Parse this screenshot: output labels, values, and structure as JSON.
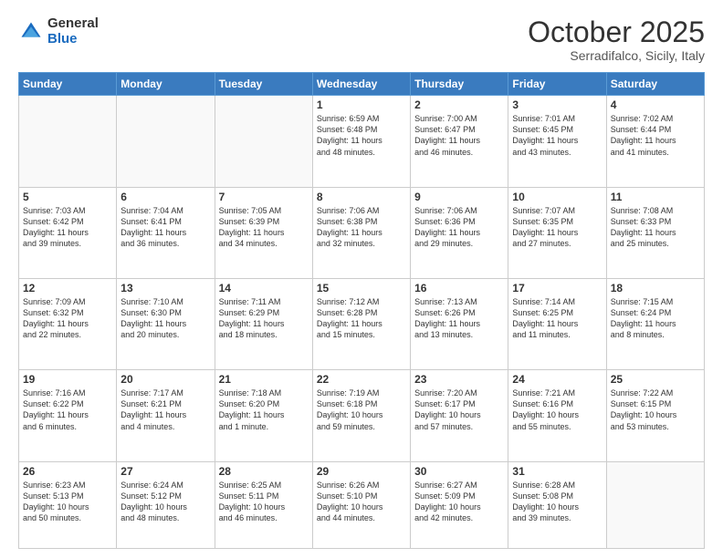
{
  "logo": {
    "general": "General",
    "blue": "Blue"
  },
  "header": {
    "month": "October 2025",
    "location": "Serradifalco, Sicily, Italy"
  },
  "weekdays": [
    "Sunday",
    "Monday",
    "Tuesday",
    "Wednesday",
    "Thursday",
    "Friday",
    "Saturday"
  ],
  "weeks": [
    [
      {
        "day": "",
        "info": ""
      },
      {
        "day": "",
        "info": ""
      },
      {
        "day": "",
        "info": ""
      },
      {
        "day": "1",
        "info": "Sunrise: 6:59 AM\nSunset: 6:48 PM\nDaylight: 11 hours\nand 48 minutes."
      },
      {
        "day": "2",
        "info": "Sunrise: 7:00 AM\nSunset: 6:47 PM\nDaylight: 11 hours\nand 46 minutes."
      },
      {
        "day": "3",
        "info": "Sunrise: 7:01 AM\nSunset: 6:45 PM\nDaylight: 11 hours\nand 43 minutes."
      },
      {
        "day": "4",
        "info": "Sunrise: 7:02 AM\nSunset: 6:44 PM\nDaylight: 11 hours\nand 41 minutes."
      }
    ],
    [
      {
        "day": "5",
        "info": "Sunrise: 7:03 AM\nSunset: 6:42 PM\nDaylight: 11 hours\nand 39 minutes."
      },
      {
        "day": "6",
        "info": "Sunrise: 7:04 AM\nSunset: 6:41 PM\nDaylight: 11 hours\nand 36 minutes."
      },
      {
        "day": "7",
        "info": "Sunrise: 7:05 AM\nSunset: 6:39 PM\nDaylight: 11 hours\nand 34 minutes."
      },
      {
        "day": "8",
        "info": "Sunrise: 7:06 AM\nSunset: 6:38 PM\nDaylight: 11 hours\nand 32 minutes."
      },
      {
        "day": "9",
        "info": "Sunrise: 7:06 AM\nSunset: 6:36 PM\nDaylight: 11 hours\nand 29 minutes."
      },
      {
        "day": "10",
        "info": "Sunrise: 7:07 AM\nSunset: 6:35 PM\nDaylight: 11 hours\nand 27 minutes."
      },
      {
        "day": "11",
        "info": "Sunrise: 7:08 AM\nSunset: 6:33 PM\nDaylight: 11 hours\nand 25 minutes."
      }
    ],
    [
      {
        "day": "12",
        "info": "Sunrise: 7:09 AM\nSunset: 6:32 PM\nDaylight: 11 hours\nand 22 minutes."
      },
      {
        "day": "13",
        "info": "Sunrise: 7:10 AM\nSunset: 6:30 PM\nDaylight: 11 hours\nand 20 minutes."
      },
      {
        "day": "14",
        "info": "Sunrise: 7:11 AM\nSunset: 6:29 PM\nDaylight: 11 hours\nand 18 minutes."
      },
      {
        "day": "15",
        "info": "Sunrise: 7:12 AM\nSunset: 6:28 PM\nDaylight: 11 hours\nand 15 minutes."
      },
      {
        "day": "16",
        "info": "Sunrise: 7:13 AM\nSunset: 6:26 PM\nDaylight: 11 hours\nand 13 minutes."
      },
      {
        "day": "17",
        "info": "Sunrise: 7:14 AM\nSunset: 6:25 PM\nDaylight: 11 hours\nand 11 minutes."
      },
      {
        "day": "18",
        "info": "Sunrise: 7:15 AM\nSunset: 6:24 PM\nDaylight: 11 hours\nand 8 minutes."
      }
    ],
    [
      {
        "day": "19",
        "info": "Sunrise: 7:16 AM\nSunset: 6:22 PM\nDaylight: 11 hours\nand 6 minutes."
      },
      {
        "day": "20",
        "info": "Sunrise: 7:17 AM\nSunset: 6:21 PM\nDaylight: 11 hours\nand 4 minutes."
      },
      {
        "day": "21",
        "info": "Sunrise: 7:18 AM\nSunset: 6:20 PM\nDaylight: 11 hours\nand 1 minute."
      },
      {
        "day": "22",
        "info": "Sunrise: 7:19 AM\nSunset: 6:18 PM\nDaylight: 10 hours\nand 59 minutes."
      },
      {
        "day": "23",
        "info": "Sunrise: 7:20 AM\nSunset: 6:17 PM\nDaylight: 10 hours\nand 57 minutes."
      },
      {
        "day": "24",
        "info": "Sunrise: 7:21 AM\nSunset: 6:16 PM\nDaylight: 10 hours\nand 55 minutes."
      },
      {
        "day": "25",
        "info": "Sunrise: 7:22 AM\nSunset: 6:15 PM\nDaylight: 10 hours\nand 53 minutes."
      }
    ],
    [
      {
        "day": "26",
        "info": "Sunrise: 6:23 AM\nSunset: 5:13 PM\nDaylight: 10 hours\nand 50 minutes."
      },
      {
        "day": "27",
        "info": "Sunrise: 6:24 AM\nSunset: 5:12 PM\nDaylight: 10 hours\nand 48 minutes."
      },
      {
        "day": "28",
        "info": "Sunrise: 6:25 AM\nSunset: 5:11 PM\nDaylight: 10 hours\nand 46 minutes."
      },
      {
        "day": "29",
        "info": "Sunrise: 6:26 AM\nSunset: 5:10 PM\nDaylight: 10 hours\nand 44 minutes."
      },
      {
        "day": "30",
        "info": "Sunrise: 6:27 AM\nSunset: 5:09 PM\nDaylight: 10 hours\nand 42 minutes."
      },
      {
        "day": "31",
        "info": "Sunrise: 6:28 AM\nSunset: 5:08 PM\nDaylight: 10 hours\nand 39 minutes."
      },
      {
        "day": "",
        "info": ""
      }
    ]
  ]
}
